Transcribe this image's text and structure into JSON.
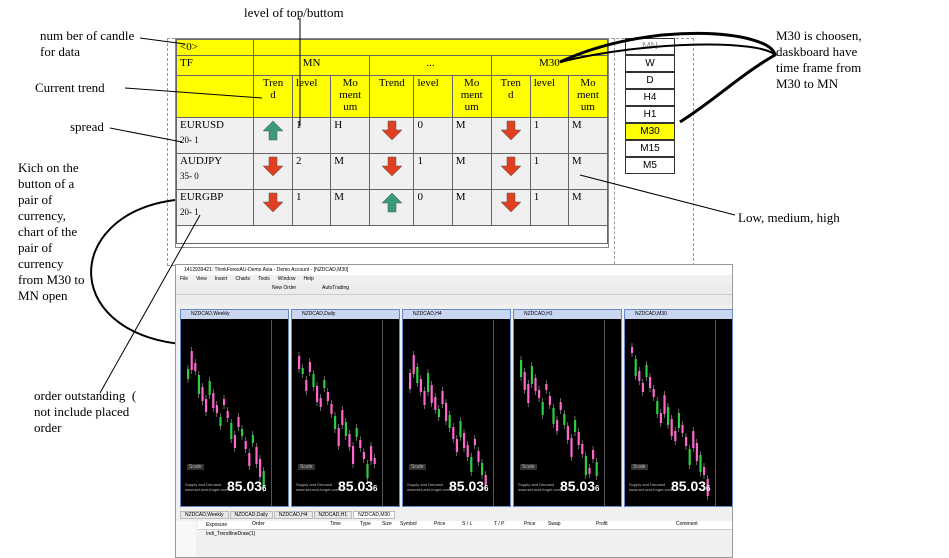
{
  "annotations": {
    "candles": "num ber of candle\nfor data",
    "level": "level of top/buttom",
    "m30": "M30 is choosen,\ndaskboard have\ntime frame from\nM30 to MN",
    "trend": "Current trend",
    "spread": "spread",
    "click": "Kich on the\nbutton of a\npair of\ncurrency,\nchart of the\npair of\ncurrency\nfrom M30 to\nMN open",
    "lmh": "Low, medium, high",
    "outstanding": "order outstanding  (\nnot include placed\norder"
  },
  "dashboard": {
    "candle_input": "<0>",
    "tf_label": "TF",
    "tf_groups": [
      "MN",
      "...",
      "M30"
    ],
    "col_trend": "Tren\nd",
    "col_trend_mid": "Trend",
    "col_level": "level",
    "col_moment": "Mo\nment\num",
    "rows": [
      {
        "pair": "EURUSD",
        "spread": "20- 1",
        "cells": [
          {
            "dir": "up",
            "level": "1",
            "m": "H"
          },
          {
            "dir": "down",
            "level": "0",
            "m": "M"
          },
          {
            "dir": "down",
            "level": "1",
            "m": "M"
          }
        ]
      },
      {
        "pair": "AUDJPY",
        "spread": "35- 0",
        "cells": [
          {
            "dir": "down",
            "level": "2",
            "m": "M"
          },
          {
            "dir": "down",
            "level": "1",
            "m": "M"
          },
          {
            "dir": "down",
            "level": "1",
            "m": "M"
          }
        ]
      },
      {
        "pair": "EURGBP",
        "spread": "20- 1",
        "cells": [
          {
            "dir": "down",
            "level": "1",
            "m": "M"
          },
          {
            "dir": "up",
            "level": "0",
            "m": "M"
          },
          {
            "dir": "down",
            "level": "1",
            "m": "M"
          }
        ]
      }
    ]
  },
  "tf_buttons": [
    "W",
    "D",
    "H4",
    "H1",
    "M30",
    "M15",
    "M5"
  ],
  "tf_selected": "M30",
  "colors": {
    "up": "#3a9a7a",
    "down": "#e04020",
    "highlight": "#ffff00"
  },
  "platform": {
    "title": "1412939421: ThinkForexAU-Demo Asia - Demo Account - [NZDCAD,M30]",
    "menu": [
      "File",
      "View",
      "Insert",
      "Charts",
      "Tools",
      "Window",
      "Help"
    ],
    "new_order": "New Order",
    "autotrading": "AutoTrading",
    "price": "85.03",
    "price_suffix": "6",
    "scale_label": "Scale",
    "source_text": "Supply and Demand\nwww.set-and-forget.com",
    "charts": [
      {
        "title": "NZDCAD,Weekly"
      },
      {
        "title": "NZDCAD,Daily"
      },
      {
        "title": "NZDCAD,H4"
      },
      {
        "title": "NZDCAD,H1"
      },
      {
        "title": "NZDCAD,M30"
      }
    ],
    "tabs": [
      "NZDCAD,Weekly",
      "NZDCAD,Daily",
      "NZDCAD,H4",
      "NZDCAD,H1",
      "NZDCAD,M30"
    ],
    "terminal_columns": [
      "Order",
      "Time",
      "Type",
      "Size",
      "Symbol",
      "Price",
      "S / L",
      "T / P",
      "Price",
      "Swap",
      "Profit",
      "Comment"
    ],
    "nav_items": [
      "Exposure",
      "Indi_TrendlineDraw(1)"
    ]
  }
}
